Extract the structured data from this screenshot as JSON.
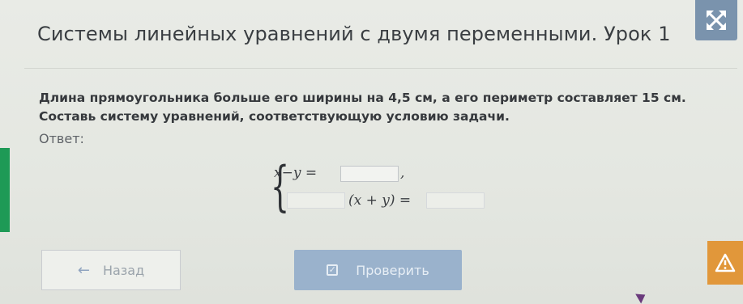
{
  "title": "Системы линейных уравнений с двумя переменными. Урок 1",
  "problem": {
    "line1": "Длина прямоугольника больше его ширины на 4,5 см, а его периметр составляет 15 см.",
    "line2": "Составь систему уравнений, соответствующую условию задачи."
  },
  "answer_label": "Ответ:",
  "system": {
    "eq1_left": "x−y =",
    "eq1_after": ",",
    "eq1_value": "",
    "eq2_coef": "",
    "eq2_mid": "(x + y) =",
    "eq2_value": ""
  },
  "buttons": {
    "back_label": "Назад",
    "check_label": "Проверить"
  },
  "icons": {
    "expand": "expand-icon",
    "back_arrow": "arrow-left-icon",
    "check": "checkbox-icon",
    "warning": "warning-icon"
  },
  "colors": {
    "accent_blue": "#7a93ad",
    "check_button": "#9ab2cc",
    "warning": "#e1973a",
    "green_tab": "#1e9a56"
  }
}
